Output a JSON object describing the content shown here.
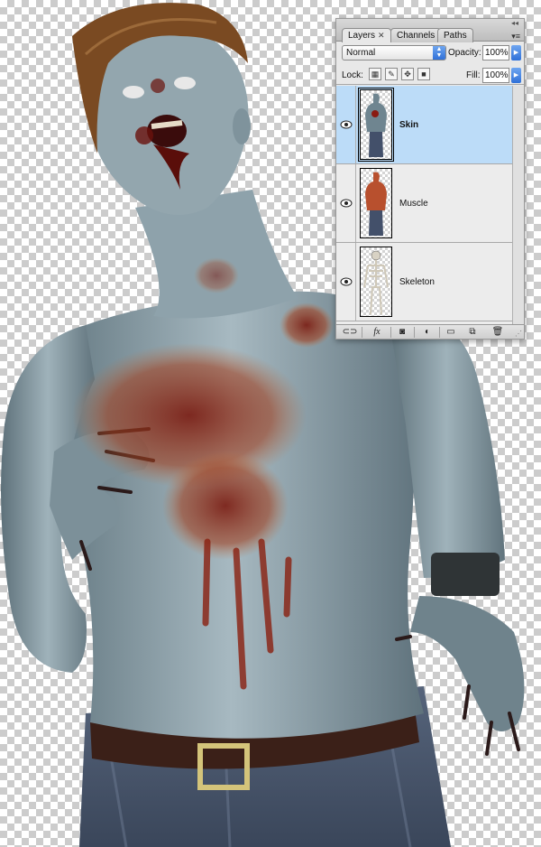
{
  "panel": {
    "tabs": [
      {
        "label": "Layers",
        "active": true
      },
      {
        "label": "Channels",
        "active": false
      },
      {
        "label": "Paths",
        "active": false
      }
    ],
    "blend_mode": "Normal",
    "opacity_label": "Opacity:",
    "opacity_value": "100%",
    "lock_label": "Lock:",
    "fill_label": "Fill:",
    "fill_value": "100%",
    "layers": [
      {
        "name": "Skin",
        "selected": true,
        "visible": true
      },
      {
        "name": "Muscle",
        "selected": false,
        "visible": true
      },
      {
        "name": "Skeleton",
        "selected": false,
        "visible": true
      }
    ],
    "bottom_buttons": [
      "link-icon",
      "fx-icon",
      "mask-icon",
      "adjustment-icon",
      "group-icon",
      "new-layer-icon",
      "trash-icon"
    ],
    "fx_label": "fx"
  },
  "colors": {
    "selection": "#bcdcf8",
    "skin": "#8ea2ab",
    "blood": "#8a1a12",
    "hair": "#7a4a22",
    "jeans": "#4a5870"
  }
}
